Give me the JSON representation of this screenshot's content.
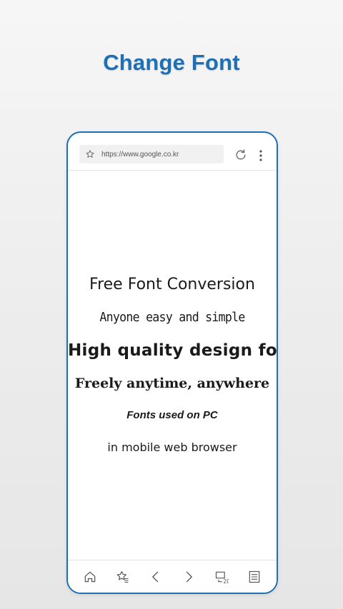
{
  "headline": "Change Font",
  "browser": {
    "url": "https://www.google.co.kr"
  },
  "content": {
    "lines": [
      "Free Font Conversion",
      "Anyone easy and simple",
      "High quality design font",
      "Freely anytime, anywhere",
      "Fonts used on PC",
      "in mobile web browser"
    ]
  },
  "navbar": {
    "tabs_count": "20",
    "icons": [
      "home-icon",
      "bookmarks-icon",
      "back-icon",
      "forward-icon",
      "tabs-icon",
      "menu-page-icon"
    ]
  },
  "colors": {
    "accent": "#1f6fb4",
    "text": "#1a1a1a",
    "background": "#ececec"
  }
}
